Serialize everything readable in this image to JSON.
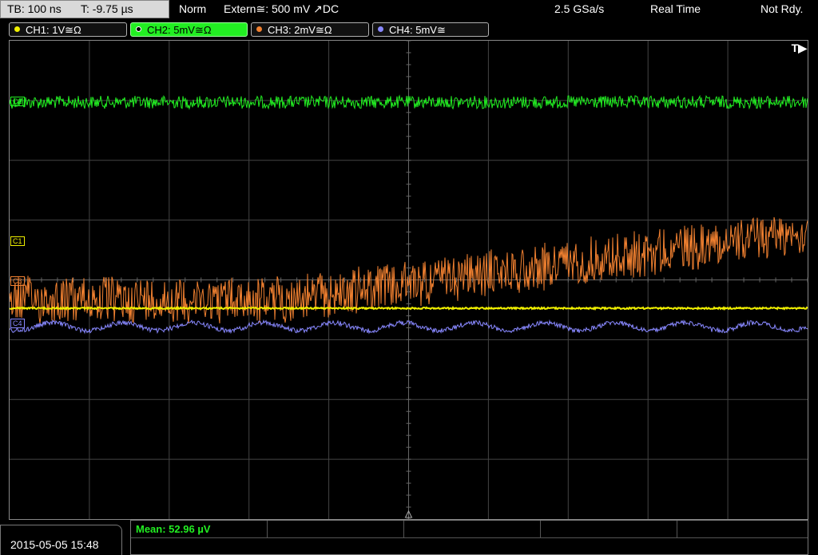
{
  "topbar": {
    "timebase": "TB: 100 ns",
    "trigger_time": "T: -9.75 µs",
    "mode": "Norm",
    "trigger_source": "Extern≅: 500 mV ↗DC",
    "sample_rate": "2.5 GSa/s",
    "acquisition": "Real Time",
    "status": "Not Rdy."
  },
  "channels": [
    {
      "label": "CH1: 1V≅Ω",
      "color": "#f0f000"
    },
    {
      "label": "CH2: 5mV≅Ω",
      "color": "#22ee22"
    },
    {
      "label": "CH3: 2mV≅Ω",
      "color": "#f08030"
    },
    {
      "label": "CH4: 5mV≅",
      "color": "#8888ff"
    }
  ],
  "plot": {
    "trigger_marker": "T▶",
    "ch1_marker": "C1",
    "ch2_marker": "C2",
    "ch3_marker": "C3",
    "ch4_marker": "C4"
  },
  "footer": {
    "datetime": "2015-05-05 15:48",
    "measurement": "Mean: 52.96 µV"
  },
  "colors": {
    "grid": "#444444",
    "ch1": "#f0f000",
    "ch2": "#22ee22",
    "ch3": "#f08030",
    "ch4": "#8888ff"
  }
}
